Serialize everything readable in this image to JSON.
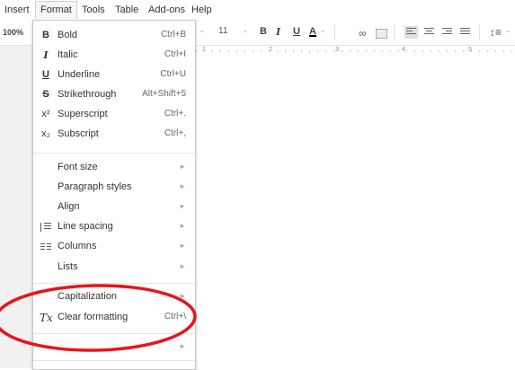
{
  "menubar": {
    "items": [
      {
        "label": "Insert"
      },
      {
        "label": "Format",
        "active": true
      },
      {
        "label": "Tools"
      },
      {
        "label": "Table"
      },
      {
        "label": "Add-ons"
      },
      {
        "label": "Help"
      }
    ]
  },
  "toolbar": {
    "zoom": "100%",
    "font_size": "11",
    "bold": "B",
    "italic": "I",
    "underline": "U",
    "text_color": "A",
    "link_icon": "link-icon",
    "comment_icon": "comment-icon",
    "align_left_active": true
  },
  "ruler": {
    "numbers": [
      "1",
      "2",
      "3",
      "4",
      "5"
    ]
  },
  "format_menu": {
    "items": [
      {
        "icon": "B",
        "icon_name": "bold-icon",
        "label": "Bold",
        "shortcut": "Ctrl+B"
      },
      {
        "icon": "I",
        "icon_name": "italic-icon",
        "label": "Italic",
        "shortcut": "Ctrl+I"
      },
      {
        "icon": "U",
        "icon_name": "underline-icon",
        "label": "Underline",
        "shortcut": "Ctrl+U"
      },
      {
        "icon": "S",
        "icon_name": "strikethrough-icon",
        "label": "Strikethrough",
        "shortcut": "Alt+Shift+5"
      },
      {
        "icon": "x²",
        "icon_name": "superscript-icon",
        "label": "Superscript",
        "shortcut": "Ctrl+."
      },
      {
        "icon": "x₂",
        "icon_name": "subscript-icon",
        "label": "Subscript",
        "shortcut": "Ctrl+,"
      },
      {
        "label": "Font size",
        "submenu": true
      },
      {
        "label": "Paragraph styles",
        "submenu": true
      },
      {
        "label": "Align",
        "submenu": true
      },
      {
        "icon_name": "line-spacing-icon",
        "label": "Line spacing",
        "submenu": true
      },
      {
        "icon_name": "columns-icon",
        "label": "Columns",
        "submenu": true
      },
      {
        "label": "Lists",
        "submenu": true
      },
      {
        "label": "Capitalization",
        "submenu": true
      },
      {
        "icon": "Tx",
        "icon_name": "clear-formatting-icon",
        "label": "Clear formatting",
        "shortcut": "Ctrl+\\"
      }
    ],
    "submenu_arrow": "►"
  },
  "annotation": {
    "color": "#e8141c",
    "shape": "ellipse",
    "highlighted_item": "Clear formatting"
  },
  "colors": {
    "menu_border": "#c6c6c6",
    "annotation_red": "#e8141c",
    "toolbar_active_bg": "#e0e0e0"
  }
}
